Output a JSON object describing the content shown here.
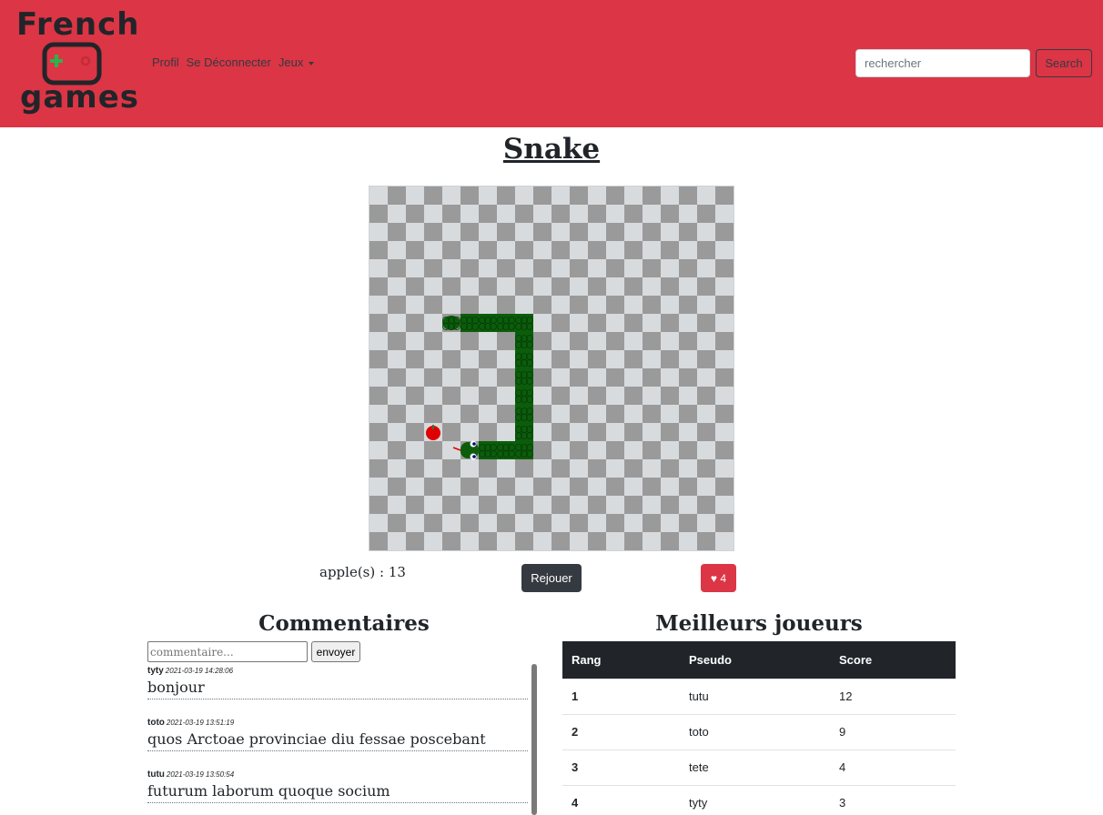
{
  "header": {
    "logo_top": "French",
    "logo_bottom": "games",
    "nav": {
      "profile": "Profil",
      "logout": "Se Déconnecter",
      "games": "Jeux"
    },
    "search": {
      "placeholder": "rechercher",
      "button": "Search"
    }
  },
  "game": {
    "title": "Snake",
    "score_label": "apple(s) : 13",
    "replay_button": "Rejouer",
    "like_icon": "heart-icon",
    "like_count": "♥ 4",
    "board": {
      "columns": 20,
      "rows": 20,
      "light_color": "#d8dbdd",
      "dark_color": "#9a9a9a",
      "snake_color": "#0b5d0b",
      "apple_color": "#e00000",
      "apple_cell": [
        3,
        13
      ],
      "snake_head_cell": [
        5,
        14
      ],
      "snake_head_direction": "left",
      "snake_cells": [
        [
          5,
          14
        ],
        [
          6,
          14
        ],
        [
          7,
          14
        ],
        [
          8,
          14
        ],
        [
          8,
          13
        ],
        [
          8,
          12
        ],
        [
          8,
          11
        ],
        [
          8,
          10
        ],
        [
          8,
          9
        ],
        [
          8,
          8
        ],
        [
          8,
          7
        ],
        [
          7,
          7
        ],
        [
          6,
          7
        ],
        [
          5,
          7
        ],
        [
          4,
          7
        ]
      ]
    }
  },
  "comments": {
    "title": "Commentaires",
    "input_placeholder": "commentaire...",
    "send_button": "envoyer",
    "items": [
      {
        "author": "tyty",
        "date": "2021-03-19 14:28:06",
        "text": "bonjour"
      },
      {
        "author": "toto",
        "date": "2021-03-19 13:51:19",
        "text": "quos Arctoae provinciae diu fessae poscebant"
      },
      {
        "author": "tutu",
        "date": "2021-03-19 13:50:54",
        "text": "futurum laborum quoque socium"
      }
    ]
  },
  "leaderboard": {
    "title": "Meilleurs joueurs",
    "headers": [
      "Rang",
      "Pseudo",
      "Score"
    ],
    "rows": [
      {
        "rank": "1",
        "pseudo": "tutu",
        "score": "12"
      },
      {
        "rank": "2",
        "pseudo": "toto",
        "score": "9"
      },
      {
        "rank": "3",
        "pseudo": "tete",
        "score": "4"
      },
      {
        "rank": "4",
        "pseudo": "tyty",
        "score": "3"
      }
    ]
  }
}
